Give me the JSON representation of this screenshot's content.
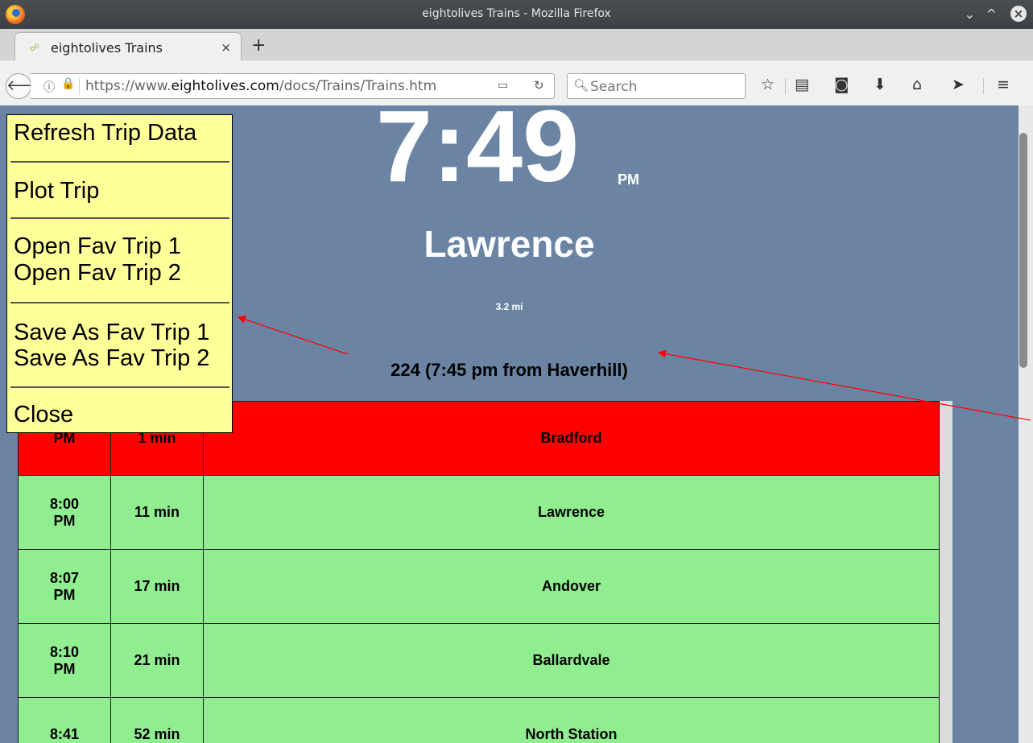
{
  "window": {
    "title": "eightolives Trains - Mozilla Firefox"
  },
  "tab": {
    "title": "eightolives Trains",
    "close": "×",
    "new_tab": "+"
  },
  "navbar": {
    "url_prefix": "https://www.",
    "url_domain": "eightolives.com",
    "url_path": "/docs/Trains/Trains.htm",
    "search_placeholder": "Search"
  },
  "page": {
    "clock": "7:49",
    "ampm": "PM",
    "station": "Lawrence",
    "distance": "3.2 mi",
    "trip": "224 (7:45 pm from Haverhill)"
  },
  "schedule": [
    {
      "time_line1": "",
      "time_line2": "PM",
      "wait": "1 min",
      "station": "Bradford",
      "status_color": "#ff0000"
    },
    {
      "time_line1": "8:00",
      "time_line2": "PM",
      "wait": "11 min",
      "station": "Lawrence",
      "status_color": "#90ee90"
    },
    {
      "time_line1": "8:07",
      "time_line2": "PM",
      "wait": "17 min",
      "station": "Andover",
      "status_color": "#90ee90"
    },
    {
      "time_line1": "8:10",
      "time_line2": "PM",
      "wait": "21 min",
      "station": "Ballardvale",
      "status_color": "#90ee90"
    },
    {
      "time_line1": "8:41",
      "time_line2": "",
      "wait": "52 min",
      "station": "North Station",
      "status_color": "#90ee90"
    }
  ],
  "menu": {
    "refresh": "Refresh Trip Data",
    "plot": "Plot Trip",
    "open_fav_1": "Open Fav Trip 1",
    "open_fav_2": "Open Fav Trip 2",
    "save_fav_1": "Save As Fav Trip 1",
    "save_fav_2": "Save As Fav Trip 2",
    "close": "Close"
  },
  "colors": {
    "page_bg": "#6b84a3",
    "menu_bg": "#ffff99",
    "arrow": "#ff0000"
  },
  "icons": [
    "firefox-icon",
    "back-icon",
    "info-icon",
    "lock-icon",
    "reader-icon",
    "reload-icon",
    "search-icon",
    "bookmark-star-icon",
    "library-icon",
    "pocket-icon",
    "download-icon",
    "home-icon",
    "send-icon",
    "hamburger-menu-icon"
  ]
}
